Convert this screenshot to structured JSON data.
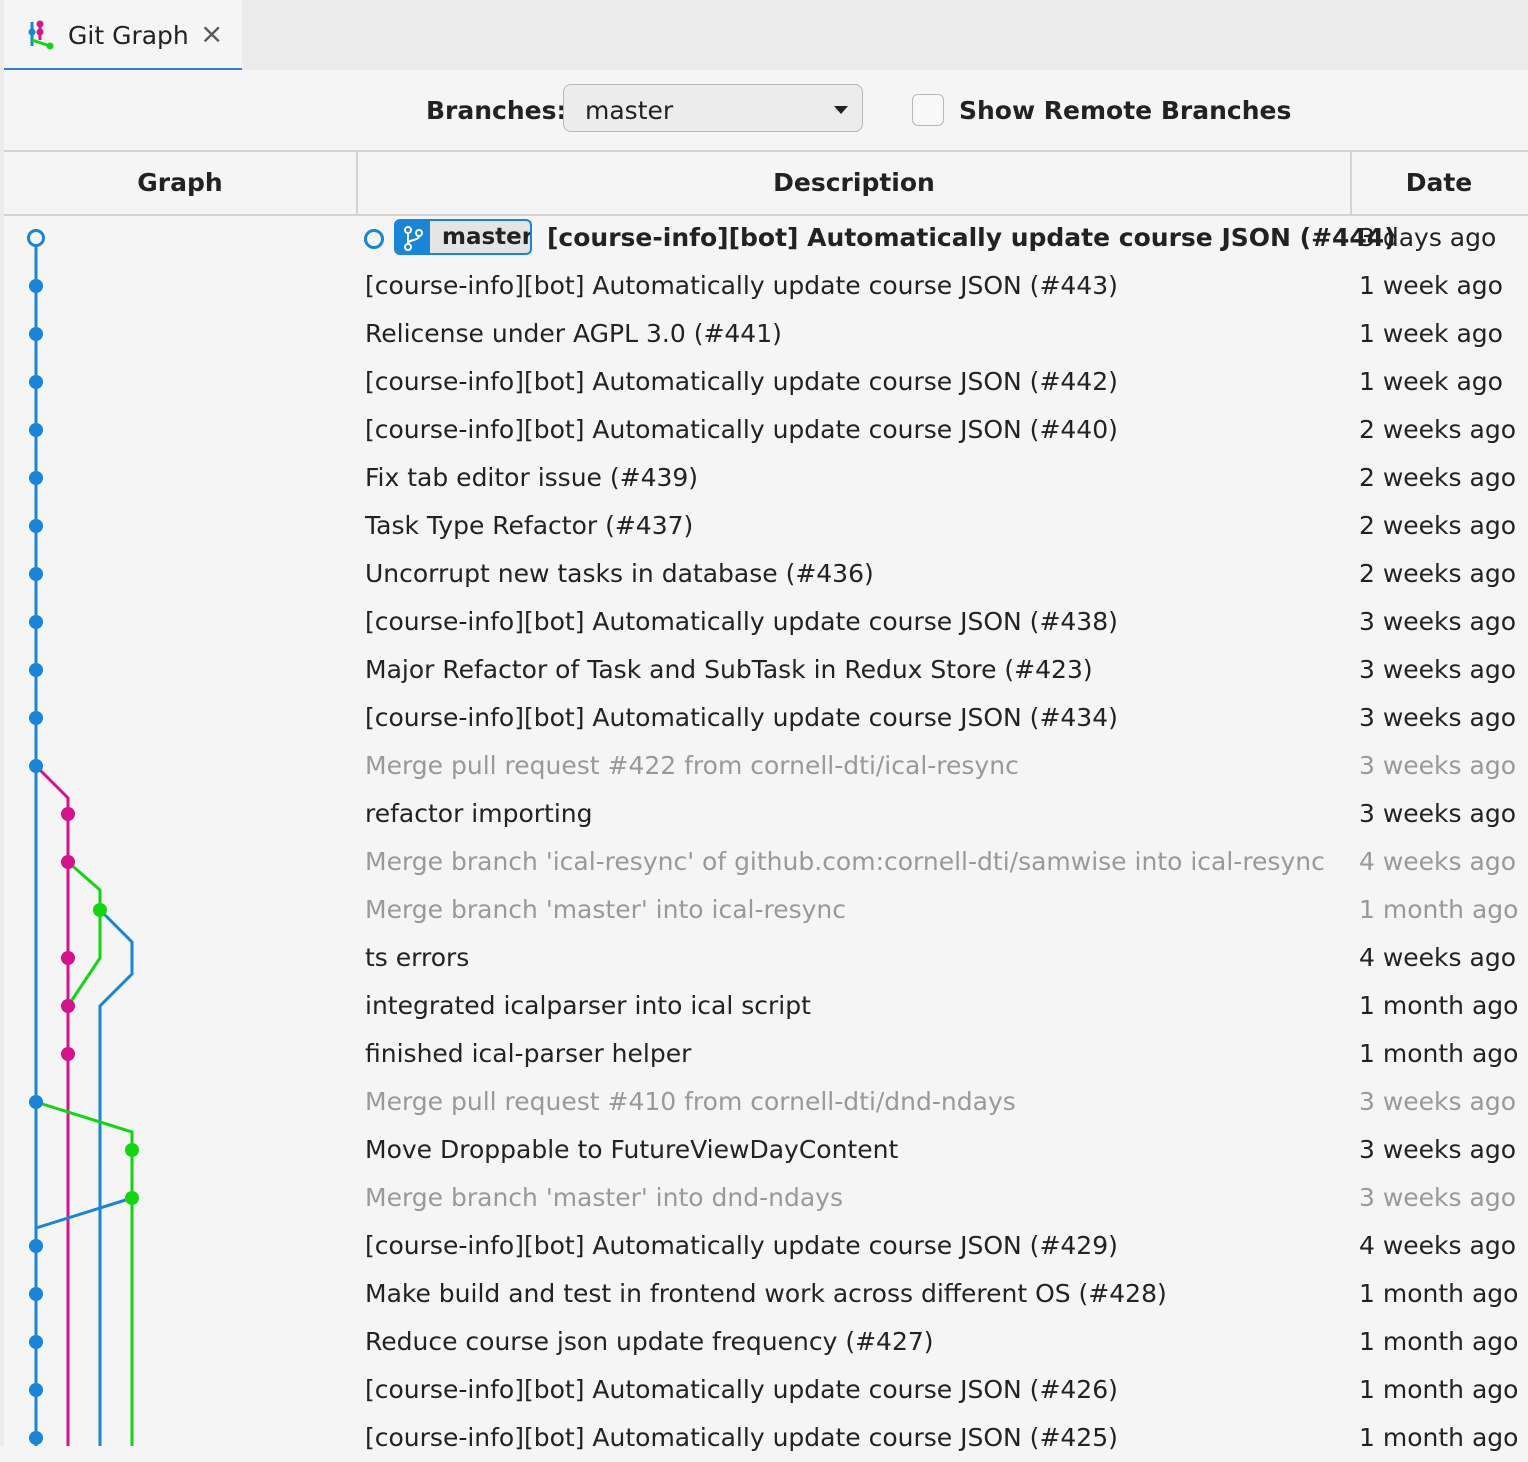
{
  "tab": {
    "title": "Git Graph",
    "close_icon": "×"
  },
  "controls": {
    "branches_label": "Branches:",
    "branch_selected": "master",
    "show_remote_label": "Show Remote Branches",
    "show_remote_checked": false
  },
  "table": {
    "headers": {
      "graph": "Graph",
      "description": "Description",
      "date": "Date"
    }
  },
  "colors": {
    "blue": "#1a85d6",
    "magenta": "#d4148c",
    "green": "#14d414",
    "merge_text": "#999999"
  },
  "commits": [
    {
      "message": "[course-info][bot] Automatically update course JSON (#444)",
      "date": "3 days ago",
      "branch_ref": "master",
      "head": true,
      "merge": false,
      "lane": 0
    },
    {
      "message": "[course-info][bot] Automatically update course JSON (#443)",
      "date": "1 week ago",
      "merge": false,
      "lane": 0
    },
    {
      "message": "Relicense under AGPL 3.0 (#441)",
      "date": "1 week ago",
      "merge": false,
      "lane": 0
    },
    {
      "message": "[course-info][bot] Automatically update course JSON (#442)",
      "date": "1 week ago",
      "merge": false,
      "lane": 0
    },
    {
      "message": "[course-info][bot] Automatically update course JSON (#440)",
      "date": "2 weeks ago",
      "merge": false,
      "lane": 0
    },
    {
      "message": "Fix tab editor issue (#439)",
      "date": "2 weeks ago",
      "merge": false,
      "lane": 0
    },
    {
      "message": "Task Type Refactor (#437)",
      "date": "2 weeks ago",
      "merge": false,
      "lane": 0
    },
    {
      "message": "Uncorrupt new tasks in database (#436)",
      "date": "2 weeks ago",
      "merge": false,
      "lane": 0
    },
    {
      "message": "[course-info][bot] Automatically update course JSON (#438)",
      "date": "3 weeks ago",
      "merge": false,
      "lane": 0
    },
    {
      "message": "Major Refactor of Task and SubTask in Redux Store (#423)",
      "date": "3 weeks ago",
      "merge": false,
      "lane": 0
    },
    {
      "message": "[course-info][bot] Automatically update course JSON (#434)",
      "date": "3 weeks ago",
      "merge": false,
      "lane": 0
    },
    {
      "message": "Merge pull request #422 from cornell-dti/ical-resync",
      "date": "3 weeks ago",
      "merge": true,
      "lane": 0
    },
    {
      "message": "refactor importing",
      "date": "3 weeks ago",
      "merge": false,
      "lane": 1
    },
    {
      "message": "Merge branch 'ical-resync' of github.com:cornell-dti/samwise into ical-resync",
      "date": "4 weeks ago",
      "merge": true,
      "lane": 1
    },
    {
      "message": "Merge branch 'master' into ical-resync",
      "date": "1 month ago",
      "merge": true,
      "lane": 2
    },
    {
      "message": "ts errors",
      "date": "4 weeks ago",
      "merge": false,
      "lane": 1
    },
    {
      "message": "integrated icalparser into ical script",
      "date": "1 month ago",
      "merge": false,
      "lane": 1
    },
    {
      "message": "finished ical-parser helper",
      "date": "1 month ago",
      "merge": false,
      "lane": 1
    },
    {
      "message": "Merge pull request #410 from cornell-dti/dnd-ndays",
      "date": "3 weeks ago",
      "merge": true,
      "lane": 0
    },
    {
      "message": "Move Droppable to FutureViewDayContent",
      "date": "3 weeks ago",
      "merge": false,
      "lane": 3
    },
    {
      "message": "Merge branch 'master' into dnd-ndays",
      "date": "3 weeks ago",
      "merge": true,
      "lane": 3
    },
    {
      "message": "[course-info][bot] Automatically update course JSON (#429)",
      "date": "4 weeks ago",
      "merge": false,
      "lane": 0
    },
    {
      "message": "Make build and test in frontend work across different OS (#428)",
      "date": "1 month ago",
      "merge": false,
      "lane": 0
    },
    {
      "message": "Reduce course json update frequency (#427)",
      "date": "1 month ago",
      "merge": false,
      "lane": 0
    },
    {
      "message": "[course-info][bot] Automatically update course JSON (#426)",
      "date": "1 month ago",
      "merge": false,
      "lane": 0
    },
    {
      "message": "[course-info][bot] Automatically update course JSON (#425)",
      "date": "1 month ago",
      "merge": false,
      "lane": 0
    }
  ]
}
